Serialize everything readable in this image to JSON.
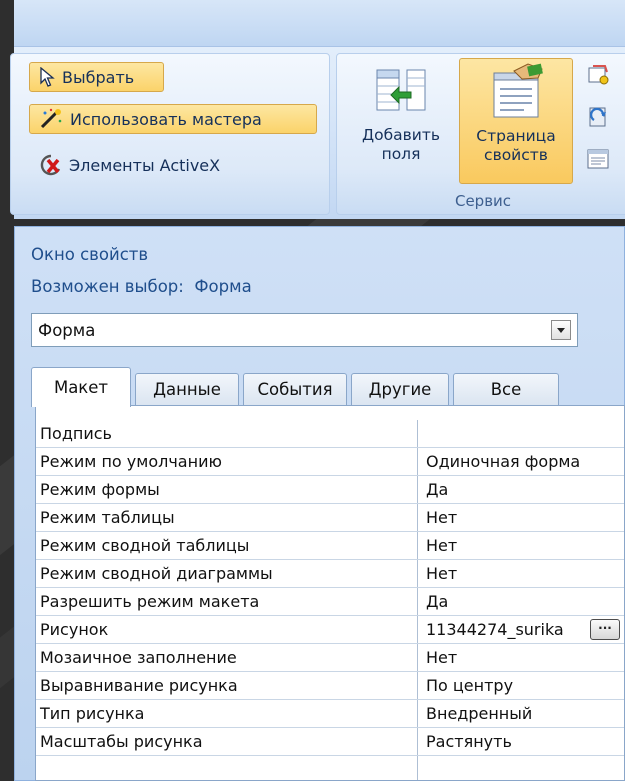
{
  "ribbon": {
    "controls_group": {
      "select_label": "Выбрать",
      "wizard_label": "Использовать мастера",
      "activex_label": "Элементы ActiveX"
    },
    "tools_group": {
      "caption": "Сервис",
      "add_fields_line1": "Добавить",
      "add_fields_line2": "поля",
      "property_sheet_line1": "Страница",
      "property_sheet_line2": "свойств"
    }
  },
  "property_sheet": {
    "title": "Окно свойств",
    "selection_label": "Возможен выбор:",
    "selection_value": "Форма",
    "combo_value": "Форма",
    "tabs": [
      {
        "label": "Макет",
        "selected": true
      },
      {
        "label": "Данные",
        "selected": false
      },
      {
        "label": "События",
        "selected": false
      },
      {
        "label": "Другие",
        "selected": false
      },
      {
        "label": "Все",
        "selected": false
      }
    ],
    "rows": [
      {
        "name": "Подпись",
        "value": ""
      },
      {
        "name": "Режим по умолчанию",
        "value": "Одиночная форма"
      },
      {
        "name": "Режим формы",
        "value": "Да"
      },
      {
        "name": "Режим таблицы",
        "value": "Нет"
      },
      {
        "name": "Режим сводной таблицы",
        "value": "Нет"
      },
      {
        "name": "Режим сводной диаграммы",
        "value": "Нет"
      },
      {
        "name": "Разрешить режим макета",
        "value": "Да"
      },
      {
        "name": "Рисунок",
        "value": "11344274_surika"
      },
      {
        "name": "Мозаичное заполнение",
        "value": "Нет"
      },
      {
        "name": "Выравнивание рисунка",
        "value": "По центру"
      },
      {
        "name": "Тип рисунка",
        "value": "Внедренный"
      },
      {
        "name": "Масштабы рисунка",
        "value": "Растянуть"
      }
    ],
    "ellipsis_label": "···"
  },
  "colors": {
    "background": "#2e2e2e",
    "ribbon": "#cddff6",
    "active_button": "#fbd36a",
    "panel_text": "#1f4e8c"
  },
  "icons": [
    "cursor-arrow-icon",
    "magic-wand-icon",
    "activex-icon",
    "add-fields-icon",
    "property-sheet-icon",
    "tab-order-icon",
    "refresh-icon",
    "code-view-icon"
  ]
}
